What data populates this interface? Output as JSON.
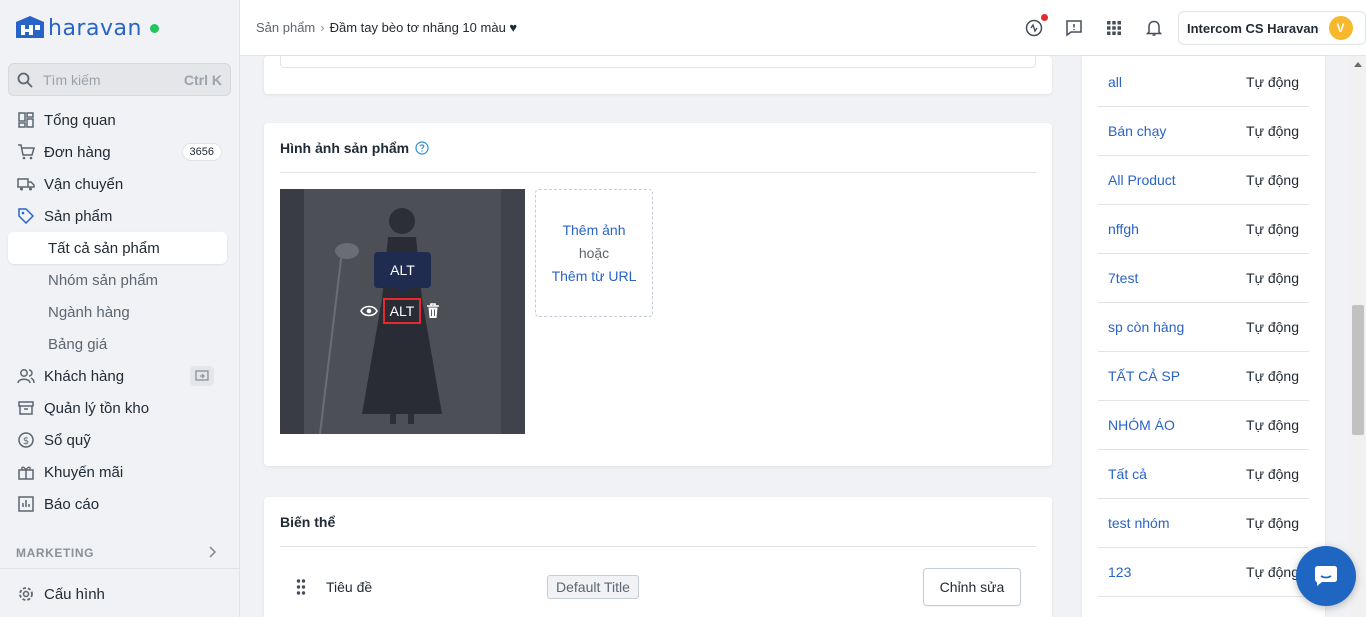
{
  "brand": {
    "name": "haravan",
    "color": "#2a63c8"
  },
  "search": {
    "placeholder": "Tìm kiếm",
    "shortcut": "Ctrl K"
  },
  "sidebar": {
    "items": [
      {
        "label": "Tổng quan",
        "icon": "dashboard-icon"
      },
      {
        "label": "Đơn hàng",
        "icon": "cart-icon",
        "badge": "3656"
      },
      {
        "label": "Vận chuyển",
        "icon": "truck-icon"
      },
      {
        "label": "Sản phẩm",
        "icon": "tag-icon"
      },
      {
        "label": "Khách hàng",
        "icon": "users-icon"
      },
      {
        "label": "Quản lý tồn kho",
        "icon": "inventory-icon"
      },
      {
        "label": "Sổ quỹ",
        "icon": "dollar-icon"
      },
      {
        "label": "Khuyến mãi",
        "icon": "gift-icon"
      },
      {
        "label": "Báo cáo",
        "icon": "report-icon"
      }
    ],
    "product_sub": [
      "Tất cả sản phẩm",
      "Nhóm sản phẩm",
      "Ngành hàng",
      "Bảng giá"
    ],
    "section_label": "MARKETING",
    "settings_label": "Cấu hình"
  },
  "header": {
    "breadcrumb_parent": "Sản phẩm",
    "breadcrumb_current": "Đầm tay bèo tơ nhăng 10 màu ♥",
    "account_name": "Intercom CS Haravan",
    "avatar_letter": "V"
  },
  "images_card": {
    "title": "Hình ảnh sản phẩm",
    "tooltip": "ALT",
    "alt_button": "ALT",
    "add_image": "Thêm ảnh",
    "or": "hoặc",
    "add_url": "Thêm từ URL"
  },
  "variants_card": {
    "title": "Biến thể",
    "row_label": "Tiêu đề",
    "default_value": "Default Title",
    "edit_button": "Chỉnh sửa"
  },
  "collections": [
    {
      "name": "all",
      "type": "Tự động"
    },
    {
      "name": "Bán chạy",
      "type": "Tự động"
    },
    {
      "name": "All Product",
      "type": "Tự động"
    },
    {
      "name": "nffgh",
      "type": "Tự động"
    },
    {
      "name": "7test",
      "type": "Tự động"
    },
    {
      "name": "sp còn hàng",
      "type": "Tự động"
    },
    {
      "name": "TẤT CẢ SP",
      "type": "Tự động"
    },
    {
      "name": "NHÓM ÁO",
      "type": "Tự động"
    },
    {
      "name": "Tất cả",
      "type": "Tự động"
    },
    {
      "name": "test nhóm",
      "type": "Tự động"
    },
    {
      "name": "123",
      "type": "Tự động"
    }
  ]
}
